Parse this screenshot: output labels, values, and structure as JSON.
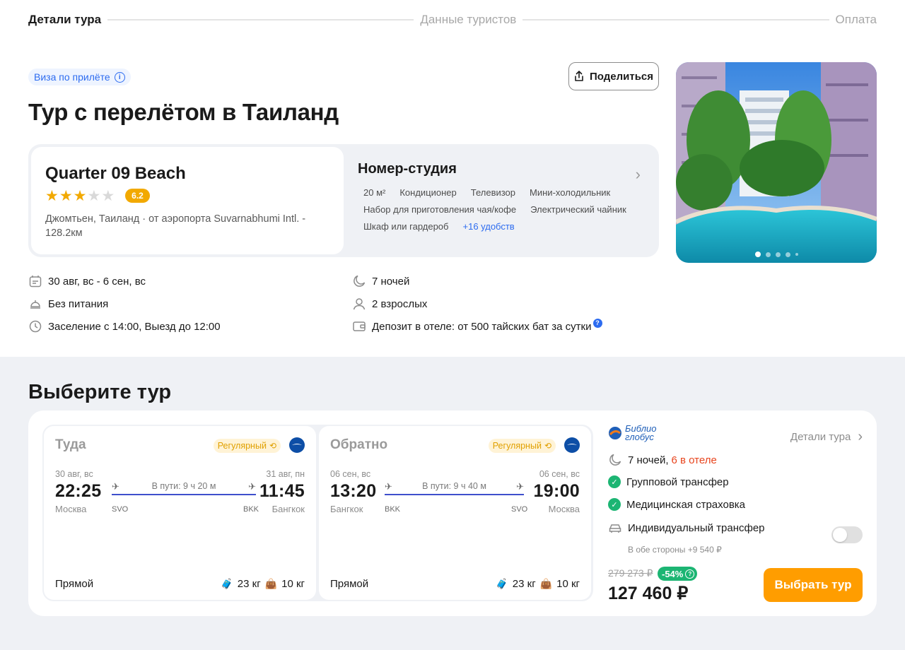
{
  "stepper": {
    "step1": "Детали тура",
    "step2": "Данные туристов",
    "step3": "Оплата"
  },
  "header": {
    "visa_label": "Виза по прилёте",
    "share_label": "Поделиться",
    "title": "Тур с перелётом в Таиланд"
  },
  "hotel": {
    "name": "Quarter 09 Beach",
    "stars": 3,
    "stars_max": 5,
    "rating": "6.2",
    "location": "Джомтьен, Таиланд · от аэропорта Suvarnabhumi Intl. - 128.2км"
  },
  "room": {
    "title": "Номер-студия",
    "amenities": [
      "20 м²",
      "Кондиционер",
      "Телевизор",
      "Мини-холодильник",
      "Набор для приготовления чая/кофе",
      "Электрический чайник",
      "Шкаф или гардероб"
    ],
    "more": "+16 удобств"
  },
  "gallery": {
    "slides": 5,
    "active_slide": 1
  },
  "facts": {
    "dates": "30 авг, вс - 6 сен, вс",
    "nights": "7 ночей",
    "meal": "Без питания",
    "guests": "2 взрослых",
    "checkin": "Заселение с 14:00, Выезд до 12:00",
    "deposit": "Депозит в отеле: от 500 тайских бат за сутки",
    "deposit_help": "?"
  },
  "choose": {
    "title": "Выберите тур"
  },
  "flights": [
    {
      "direction": "Туда",
      "badge": "Регулярный",
      "dep_date": "30 авг, вс",
      "dep_time": "22:25",
      "dep_city": "Москва",
      "dep_code": "SVO",
      "duration": "В пути: 9 ч 20 м",
      "arr_date": "31 авг, пн",
      "arr_time": "11:45",
      "arr_city": "Бангкок",
      "arr_code": "BKK",
      "type": "Прямой",
      "baggage": "23 кг",
      "hand": "10 кг"
    },
    {
      "direction": "Обратно",
      "badge": "Регулярный",
      "dep_date": "06 сен, вс",
      "dep_time": "13:20",
      "dep_city": "Бангкок",
      "dep_code": "BKK",
      "duration": "В пути: 9 ч 40 м",
      "arr_date": "06 сен, вс",
      "arr_time": "19:00",
      "arr_city": "Москва",
      "arr_code": "SVO",
      "type": "Прямой",
      "baggage": "23 кг",
      "hand": "10 кг"
    }
  ],
  "tour": {
    "operator_line1": "Библио",
    "operator_line2": "глобус",
    "details_link": "Детали тура",
    "nights": "7 ночей,",
    "in_hotel": "6 в отеле",
    "group_transfer": "Групповой трансфер",
    "insurance": "Медицинская страховка",
    "individual_transfer": "Индивидуальный трансфер",
    "individual_note": "В обе стороны +9 540 ₽",
    "individual_enabled": false,
    "old_price": "279 273 ₽",
    "discount": "-54%",
    "price": "127 460 ₽",
    "button": "Выбрать тур"
  },
  "colors": {
    "accent_orange": "#ff9d00",
    "accent_blue": "#2d6cf0",
    "star": "#f2a900",
    "success": "#1cb573",
    "route_line": "#3e4fcc"
  }
}
